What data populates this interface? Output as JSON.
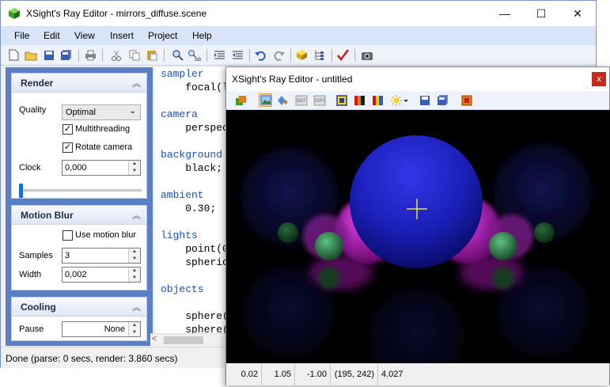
{
  "main_window": {
    "title": "XSight's Ray Editor - mirrors_diffuse.scene",
    "controls": {
      "minimize": "—",
      "maximize": "☐",
      "close": "✕"
    }
  },
  "menu": [
    "File",
    "Edit",
    "View",
    "Insert",
    "Project",
    "Help"
  ],
  "toolbar_icons": [
    "new-icon",
    "open-icon",
    "save-icon",
    "save-all-icon",
    "print-icon",
    "cut-icon",
    "copy-icon",
    "paste-icon",
    "find-icon",
    "replace-icon",
    "indent-icon",
    "outdent-icon",
    "undo-icon",
    "redo-icon",
    "object-icon",
    "tree-icon",
    "check-icon",
    "camera-icon"
  ],
  "render_panel": {
    "title": "Render",
    "quality_label": "Quality",
    "quality_value": "Optimal",
    "multithreading_label": "Multithreading",
    "multithreading_checked": true,
    "rotate_camera_label": "Rotate camera",
    "rotate_camera_checked": true,
    "clock_label": "Clock",
    "clock_value": "0,000",
    "clock_slider_position": 0
  },
  "motion_blur_panel": {
    "title": "Motion Blur",
    "use_motion_blur_label": "Use motion blur",
    "use_motion_blur_checked": false,
    "samples_label": "Samples",
    "samples_value": "3",
    "width_label": "Width",
    "width_value": "0,002"
  },
  "cooling_panel": {
    "title": "Cooling",
    "pause_label": "Pause",
    "pause_value": "None"
  },
  "editor": {
    "lines": [
      {
        "kw": "sampler",
        "rest": ""
      },
      {
        "kw": "",
        "rest": "    focal(l"
      },
      {
        "kw": "",
        "rest": ""
      },
      {
        "kw": "camera",
        "rest": ""
      },
      {
        "kw": "",
        "rest": "    perspec"
      },
      {
        "kw": "",
        "rest": ""
      },
      {
        "kw": "background",
        "rest": ""
      },
      {
        "kw": "",
        "rest": "    black;"
      },
      {
        "kw": "",
        "rest": ""
      },
      {
        "kw": "ambient",
        "rest": ""
      },
      {
        "kw": "",
        "rest": "    0.30;"
      },
      {
        "kw": "",
        "rest": ""
      },
      {
        "kw": "lights",
        "rest": ""
      },
      {
        "kw": "",
        "rest": "    point(0"
      },
      {
        "kw": "",
        "rest": "    spheric"
      },
      {
        "kw": "",
        "rest": ""
      },
      {
        "kw": "objects",
        "rest": ""
      },
      {
        "kw": "",
        "rest": ""
      },
      {
        "kw": "",
        "rest": "    sphere("
      },
      {
        "kw": "",
        "rest": "    sphere("
      }
    ]
  },
  "status_bar": "Done (parse: 0 secs, render: 3.860 secs)",
  "render_window": {
    "title": "XSight's Ray Editor - untitled",
    "close": "x",
    "toolbar_icons": [
      "scene-icon",
      "picture-icon",
      "diamond-icon",
      "nef-icon",
      "diff-icon",
      "frame-icon",
      "palette-icon",
      "colors-icon",
      "light-icon",
      "save-icon",
      "save-all-icon",
      "image-icon"
    ],
    "status": {
      "v1": "0.02",
      "v2": "1.05",
      "v3": "-1.00",
      "coords": "(195, 242)",
      "v4": "4.027"
    }
  },
  "colors": {
    "accent_blue": "#5a7fc4",
    "sphere_blue": "#1a1fb8",
    "sphere_magenta": "#b01ab8",
    "sphere_green": "#2a7a4a",
    "crosshair": "#f0e040",
    "close_red": "#c42b1c"
  }
}
